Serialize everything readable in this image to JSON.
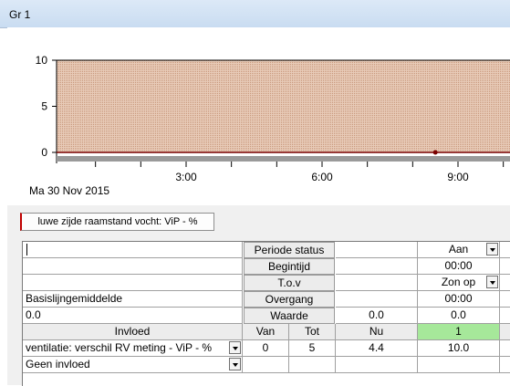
{
  "window": {
    "title": "Gr 1"
  },
  "chart_data": {
    "type": "area",
    "y_ticks": [
      "10",
      "5",
      "0"
    ],
    "x_ticks": [
      "3:00",
      "6:00",
      "9:00"
    ],
    "ylim": [
      0,
      10
    ],
    "fill_color": "#c8987c",
    "marker": {
      "x": "8:30",
      "y": 0
    }
  },
  "date_label": "Ma  30 Nov 2015",
  "tab_label": "luwe zijde raamstand vocht: ViP - %",
  "table": {
    "periode_status": "Periode status",
    "begintijd": "Begintijd",
    "tov": "T.o.v",
    "overgang": "Overgang",
    "waarde": "Waarde",
    "status_value": "Aan",
    "begintijd_value": "00:00",
    "tov_value": "Zon op",
    "overgang_value": "00:00",
    "basislijn_label": "Basislijngemiddelde",
    "basislijn_value": "0.0",
    "waarde_nu": "0.0",
    "waarde_value": "0.0",
    "headers": {
      "invloed": "Invloed",
      "van": "Van",
      "tot": "Tot",
      "nu": "Nu",
      "col1": "1"
    },
    "rows": [
      {
        "invloed": "ventilatie: verschil RV meting - ViP - %",
        "van": "0",
        "tot": "5",
        "nu": "4.4",
        "val": "10.0"
      },
      {
        "invloed": "Geen invloed",
        "van": "",
        "tot": "",
        "nu": "",
        "val": ""
      }
    ]
  }
}
